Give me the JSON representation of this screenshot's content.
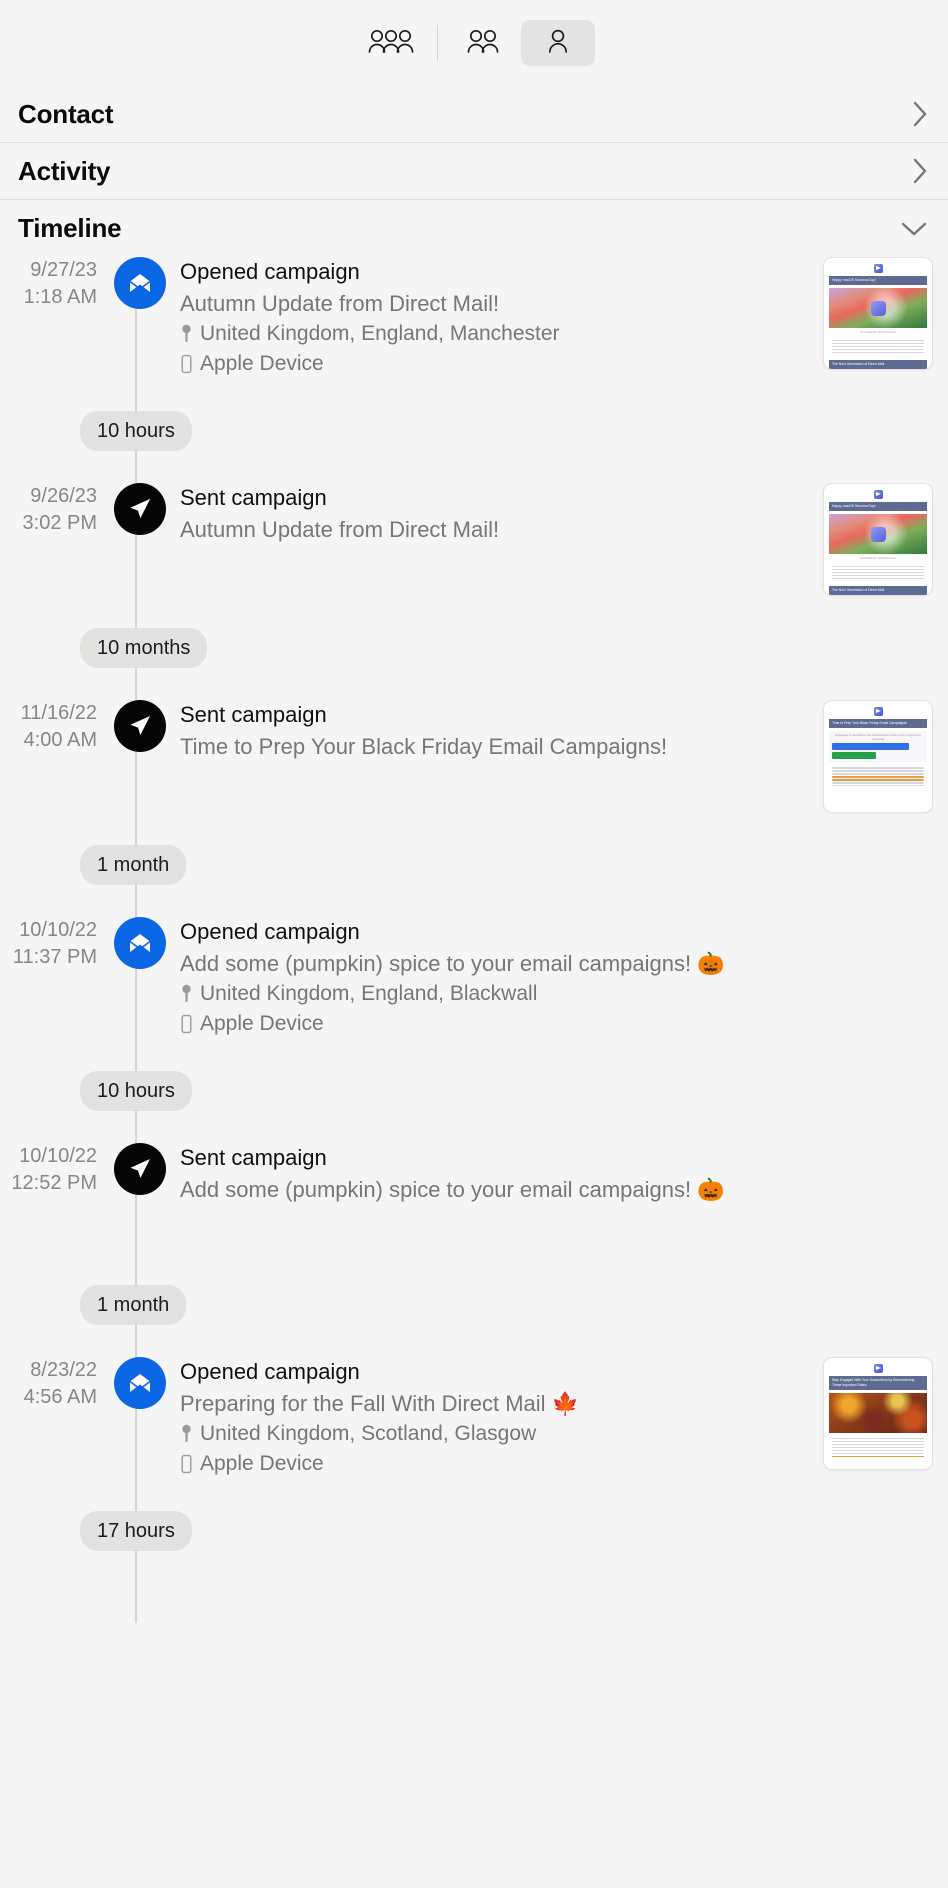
{
  "toolbar": {
    "buttons": [
      {
        "name": "all-contacts-icon",
        "label": "All contacts",
        "active": false
      },
      {
        "name": "groups-icon",
        "label": "Groups",
        "active": false
      },
      {
        "name": "single-contact-icon",
        "label": "Contact",
        "active": true
      }
    ]
  },
  "sections": [
    {
      "title": "Contact",
      "chevron": "chevron-right",
      "expanded": false
    },
    {
      "title": "Activity",
      "chevron": "chevron-right",
      "expanded": false
    },
    {
      "title": "Timeline",
      "chevron": "chevron-down",
      "expanded": true
    }
  ],
  "timeline": {
    "events": [
      {
        "date": "9/27/23",
        "time": "1:18 AM",
        "kind": "opened",
        "icon": "open-envelope-icon",
        "title": "Opened campaign",
        "subject": "Autumn Update from Direct Mail!",
        "location": "United Kingdom, England, Manchester",
        "device": "Apple Device",
        "thumbnail": {
          "style": "sonoma",
          "header": "Happy macOS Sonoma Day!",
          "caption": "Direct Mail for macOS Sonoma",
          "footer": "The Next Generation of Direct Mail"
        }
      },
      {
        "date": "9/26/23",
        "time": "3:02 PM",
        "kind": "sent",
        "icon": "paper-plane-icon",
        "title": "Sent campaign",
        "subject": "Autumn Update from Direct Mail!",
        "location": "",
        "device": "",
        "thumbnail": {
          "style": "sonoma",
          "header": "Happy macOS Sonoma Day!",
          "caption": "Direct Mail for macOS Sonoma",
          "footer": "The Next Generation of Direct Mail"
        }
      },
      {
        "date": "11/16/22",
        "time": "4:00 AM",
        "kind": "sent",
        "icon": "paper-plane-icon",
        "title": "Sent campaign",
        "subject": "Time to Prep Your Black Friday Email Campaigns!",
        "location": "",
        "device": "",
        "thumbnail": {
          "style": "chart",
          "header": "Time to Prep Your Black Friday Email Campaigns!",
          "caption": "Percentage of respondents that used the Black Friday as top or second top opportunity",
          "footer": ""
        }
      },
      {
        "date": "10/10/22",
        "time": "11:37 PM",
        "kind": "opened",
        "icon": "open-envelope-icon",
        "title": "Opened campaign",
        "subject": "Add some (pumpkin) spice to your email campaigns! 🎃",
        "location": "United Kingdom, England, Blackwall",
        "device": "Apple Device",
        "thumbnail": null
      },
      {
        "date": "10/10/22",
        "time": "12:52 PM",
        "kind": "sent",
        "icon": "paper-plane-icon",
        "title": "Sent campaign",
        "subject": "Add some (pumpkin) spice to your email campaigns! 🎃",
        "location": "",
        "device": "",
        "thumbnail": null
      },
      {
        "date": "8/23/22",
        "time": "4:56 AM",
        "kind": "opened",
        "icon": "open-envelope-icon",
        "title": "Opened campaign",
        "subject": "Preparing for the Fall With Direct Mail 🍁",
        "location": "United Kingdom, Scotland, Glasgow",
        "device": "Apple Device",
        "thumbnail": {
          "style": "fall",
          "header": "Stay Engaged With Your Subscribers by Remembering These Important Dates",
          "caption": "",
          "footer": ""
        }
      }
    ],
    "gaps": [
      "10 hours",
      "10 months",
      "1 month",
      "10 hours",
      "1 month",
      "17 hours"
    ],
    "icons": {
      "location": "map-pin-icon",
      "device": "mobile-phone-icon"
    },
    "colors": {
      "opened": "#0b66e4",
      "sent": "#050505",
      "axis": "#d5d5d3",
      "pill_bg": "#e2e2e1",
      "muted_text": "#76767a"
    }
  }
}
